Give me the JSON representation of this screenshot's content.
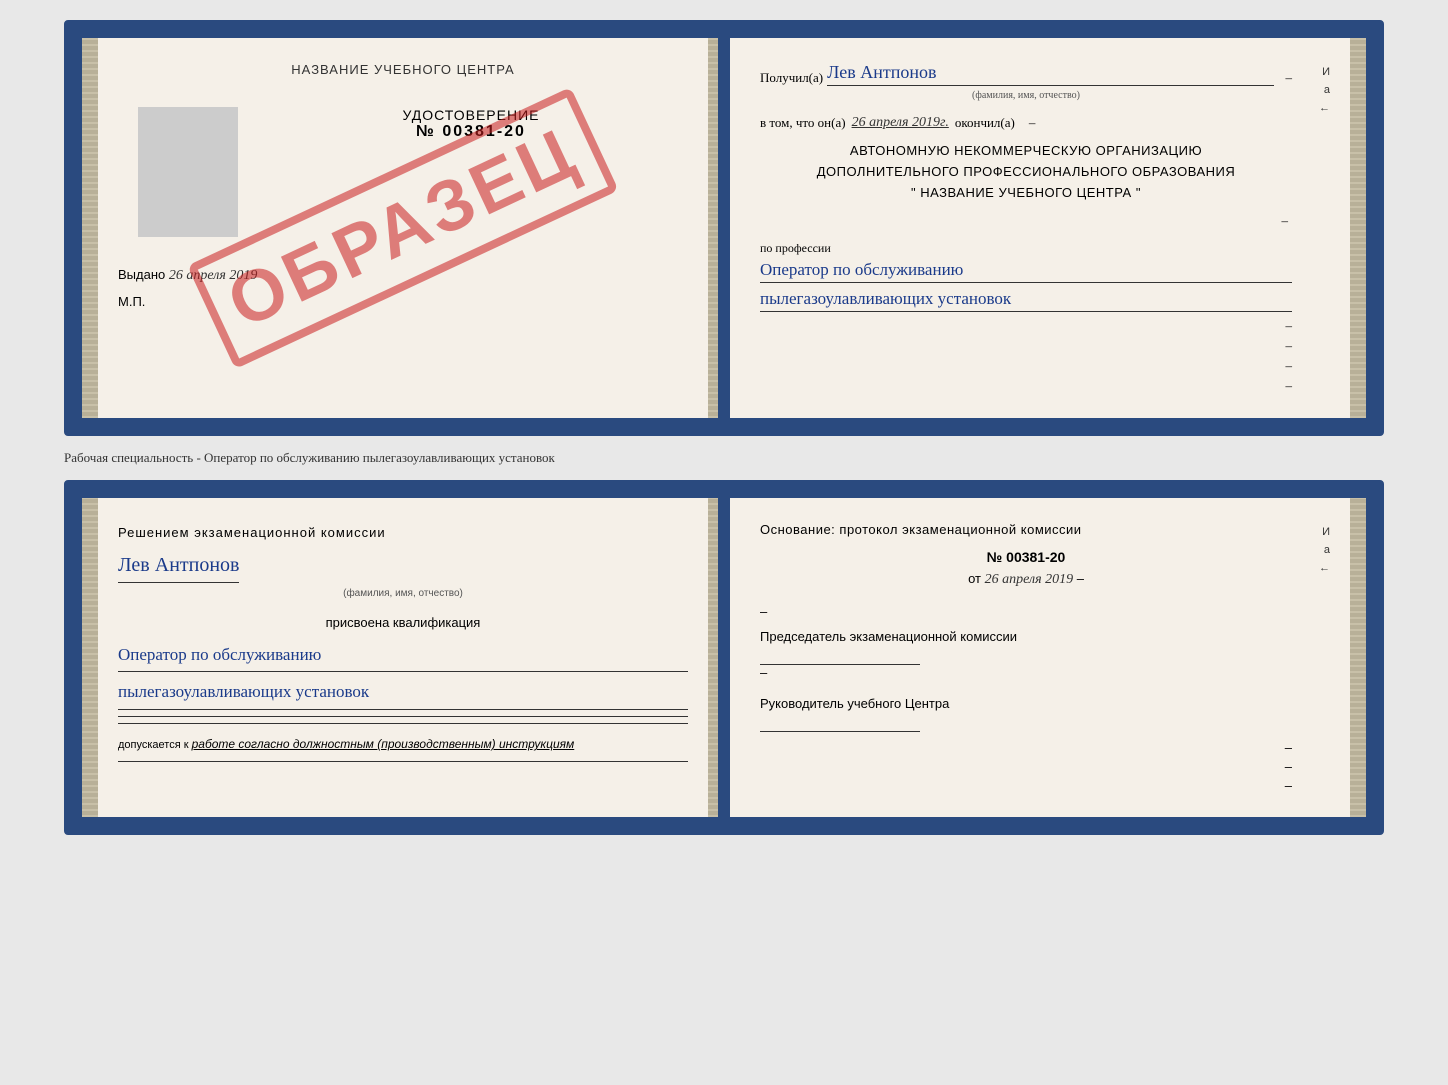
{
  "page": {
    "background": "#e8e8e8"
  },
  "doc1": {
    "left": {
      "title": "НАЗВАНИЕ УЧЕБНОГО ЦЕНТРА",
      "stamp": "ОБРАЗЕЦ",
      "udostoverenie_label": "УДОСТОВЕРЕНИЕ",
      "number": "№ 00381-20",
      "vydano_label": "Выдано",
      "vydano_date": "26 апреля 2019",
      "mp": "М.П."
    },
    "right": {
      "poluchil_label": "Получил(а)",
      "poluchil_name": "Лев Антпонов",
      "fam_sub": "(фамилия, имя, отчество)",
      "dash1": "–",
      "vtom_label": "в том, что он(а)",
      "vtom_date": "26 апреля 2019г.",
      "okonchil_label": "окончил(а)",
      "dash2": "–",
      "org_line1": "АВТОНОМНУЮ НЕКОММЕРЧЕСКУЮ ОРГАНИЗАЦИЮ",
      "org_line2": "ДОПОЛНИТЕЛЬНОГО ПРОФЕССИОНАЛЬНОГО ОБРАЗОВАНИЯ",
      "org_line3": "\"   НАЗВАНИЕ УЧЕБНОГО ЦЕНТРА   \"",
      "dash3": "–",
      "indicator_i": "И",
      "indicator_a": "а",
      "indicator_arrow": "←",
      "professiya_label": "по профессии",
      "professiya_line1": "Оператор по обслуживанию",
      "professiya_line2": "пылегазоулавливающих установок",
      "dash4": "–",
      "dash5": "–",
      "dash6": "–",
      "dash7": "–"
    }
  },
  "separator": {
    "text": "Рабочая специальность - Оператор по обслуживанию пылегазоулавливающих установок"
  },
  "doc2": {
    "left": {
      "resheniem_label": "Решением экзаменационной комиссии",
      "fio_name": "Лев Антпонов",
      "fam_sub": "(фамилия, имя, отчество)",
      "prisvoyena_label": "присвоена квалификация",
      "kvalif_line1": "Оператор по обслуживанию",
      "kvalif_line2": "пылегазоулавливающих установок",
      "dopuskaetsya_label": "допускается к",
      "dopuskaetsya_text": "работе согласно должностным (производственным) инструкциям"
    },
    "right": {
      "osnovaniye_label": "Основание: протокол экзаменационной комиссии",
      "number": "№  00381-20",
      "ot_label": "от",
      "ot_date": "26 апреля 2019",
      "dash1": "–",
      "dash2": "–",
      "predsedatel_label": "Председатель экзаменационной комиссии",
      "dash3": "–",
      "indicator_i": "И",
      "indicator_a": "а",
      "indicator_arrow": "←",
      "rukovoditel_label": "Руководитель учебного Центра",
      "dash4": "–",
      "dash5": "–",
      "dash6": "–"
    }
  }
}
